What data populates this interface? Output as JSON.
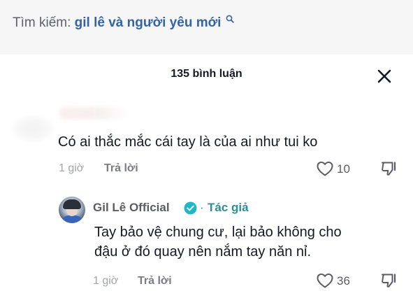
{
  "search": {
    "prefix": "Tìm kiếm:",
    "query": "gil lê và người yêu mới",
    "icon": "search-icon"
  },
  "comments_panel": {
    "count_label": "135 bình luận",
    "close_icon": "close-icon"
  },
  "comment": {
    "author": "",
    "text": "Có ai thắc mắc cái tay là của ai như tui ko",
    "time": "1 giờ",
    "reply_label": "Trả lời",
    "likes": "10"
  },
  "reply": {
    "author": "Gil Lê Official",
    "verified": true,
    "dot": "·",
    "badge": "Tác giả",
    "text_line1": "Tay bảo vệ chung cư, lại bảo không cho",
    "text_line2": "đậu ở đó quay nên nắm tay năn nỉ.",
    "time": "1 giờ",
    "reply_label": "Trả lời",
    "likes": "36"
  },
  "colors": {
    "search_bg": "#f6f6f7",
    "query": "#3563a8",
    "author_badge": "#2b8f96",
    "verified": "#20b8c8"
  }
}
